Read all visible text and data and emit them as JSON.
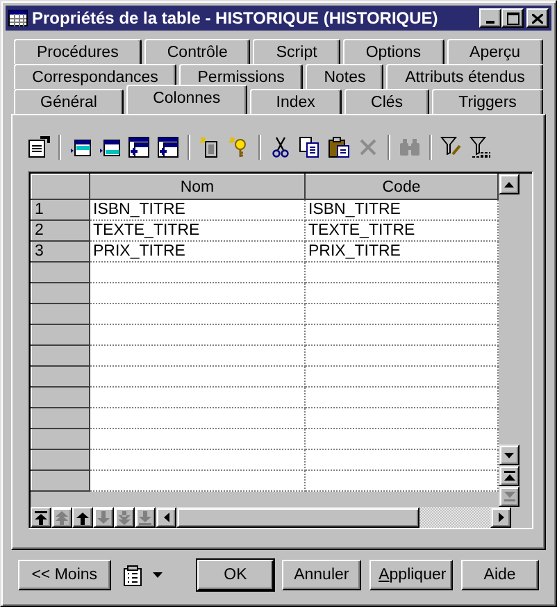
{
  "window": {
    "title": "Propriétés de la table - HISTORIQUE (HISTORIQUE)"
  },
  "tab_rows": [
    [
      {
        "label": "Procédures",
        "selected": false
      },
      {
        "label": "Contrôle",
        "selected": false
      },
      {
        "label": "Script",
        "selected": false
      },
      {
        "label": "Options",
        "selected": false
      },
      {
        "label": "Aperçu",
        "selected": false
      }
    ],
    [
      {
        "label": "Correspondances",
        "selected": false
      },
      {
        "label": "Permissions",
        "selected": false
      },
      {
        "label": "Notes",
        "selected": false
      },
      {
        "label": "Attributs étendus",
        "selected": false
      }
    ],
    [
      {
        "label": "Général",
        "selected": false
      },
      {
        "label": "Colonnes",
        "selected": true
      },
      {
        "label": "Index",
        "selected": false
      },
      {
        "label": "Clés",
        "selected": false
      },
      {
        "label": "Triggers",
        "selected": false
      }
    ]
  ],
  "toolbar": [
    [
      {
        "kind": "properties",
        "disabled": false
      }
    ],
    [
      {
        "kind": "insert",
        "disabled": false
      },
      {
        "kind": "add",
        "disabled": false
      },
      {
        "kind": "add-multiple",
        "disabled": false
      },
      {
        "kind": "reuse",
        "disabled": false
      }
    ],
    [
      {
        "kind": "new-object",
        "disabled": false
      },
      {
        "kind": "new-key",
        "disabled": false
      }
    ],
    [
      {
        "kind": "cut",
        "disabled": false
      },
      {
        "kind": "copy",
        "disabled": false
      },
      {
        "kind": "paste",
        "disabled": false
      },
      {
        "kind": "delete",
        "disabled": true
      }
    ],
    [
      {
        "kind": "find",
        "disabled": true
      }
    ],
    [
      {
        "kind": "filter-edit",
        "disabled": false
      },
      {
        "kind": "filter",
        "disabled": false
      }
    ]
  ],
  "table": {
    "columns": [
      "Nom",
      "Code"
    ],
    "rows": [
      {
        "number": "1",
        "cells": [
          "ISBN_TITRE",
          "ISBN_TITRE"
        ]
      },
      {
        "number": "2",
        "cells": [
          "TEXTE_TITRE",
          "TEXTE_TITRE"
        ]
      },
      {
        "number": "3",
        "cells": [
          "PRIX_TITRE",
          "PRIX_TITRE"
        ]
      }
    ]
  },
  "row_nav": [
    {
      "kind": "top",
      "disabled": false
    },
    {
      "kind": "up-fast",
      "disabled": true
    },
    {
      "kind": "up",
      "disabled": false
    },
    {
      "kind": "down",
      "disabled": true
    },
    {
      "kind": "down-fast",
      "disabled": true
    },
    {
      "kind": "bottom",
      "disabled": true
    }
  ],
  "scroll_jump": [
    {
      "kind": "top",
      "disabled": false
    },
    {
      "kind": "bottom",
      "disabled": true
    }
  ],
  "buttons": [
    {
      "label": "<< Moins",
      "default": false,
      "underline_first": false
    },
    {
      "kind": "menu"
    },
    {
      "label": "OK",
      "default": true,
      "underline_first": false
    },
    {
      "label": "Annuler",
      "default": false,
      "underline_first": false
    },
    {
      "label": "Appliquer",
      "default": false,
      "underline_first": true
    },
    {
      "label": "Aide",
      "default": false,
      "underline_first": false
    }
  ]
}
